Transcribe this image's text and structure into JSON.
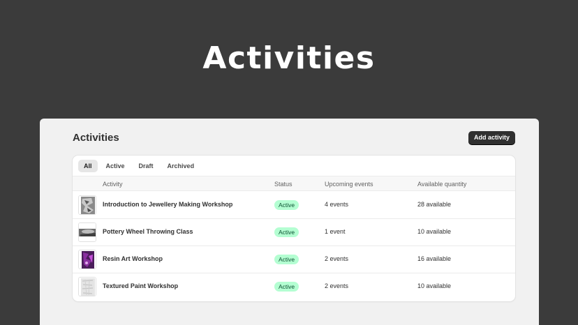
{
  "hero": {
    "title": "Activities"
  },
  "panel": {
    "title": "Activities",
    "add_button": "Add activity"
  },
  "tabs": [
    "All",
    "Active",
    "Draft",
    "Archived"
  ],
  "selected_tab": "All",
  "table": {
    "headers": {
      "activity": "Activity",
      "status": "Status",
      "upcoming": "Upcoming events",
      "available": "Available quantity"
    },
    "rows": [
      {
        "name": "Introduction to Jewellery Making Workshop",
        "status": "Active",
        "upcoming": "4 events",
        "available": "28 available",
        "thumb": "jewellery-thumbnail"
      },
      {
        "name": "Pottery Wheel Throwing Class",
        "status": "Active",
        "upcoming": "1 event",
        "available": "10 available",
        "thumb": "pottery-thumbnail"
      },
      {
        "name": "Resin Art Workshop",
        "status": "Active",
        "upcoming": "2 events",
        "available": "16 available",
        "thumb": "resin-thumbnail"
      },
      {
        "name": "Textured Paint Workshop",
        "status": "Active",
        "upcoming": "2 events",
        "available": "10 available",
        "thumb": "paint-thumbnail"
      }
    ]
  },
  "colors": {
    "background": "#3b3b3b",
    "panel": "#f1f1f1",
    "button": "#303030",
    "badge_bg": "#b4fed2",
    "badge_text": "#0c5132"
  }
}
